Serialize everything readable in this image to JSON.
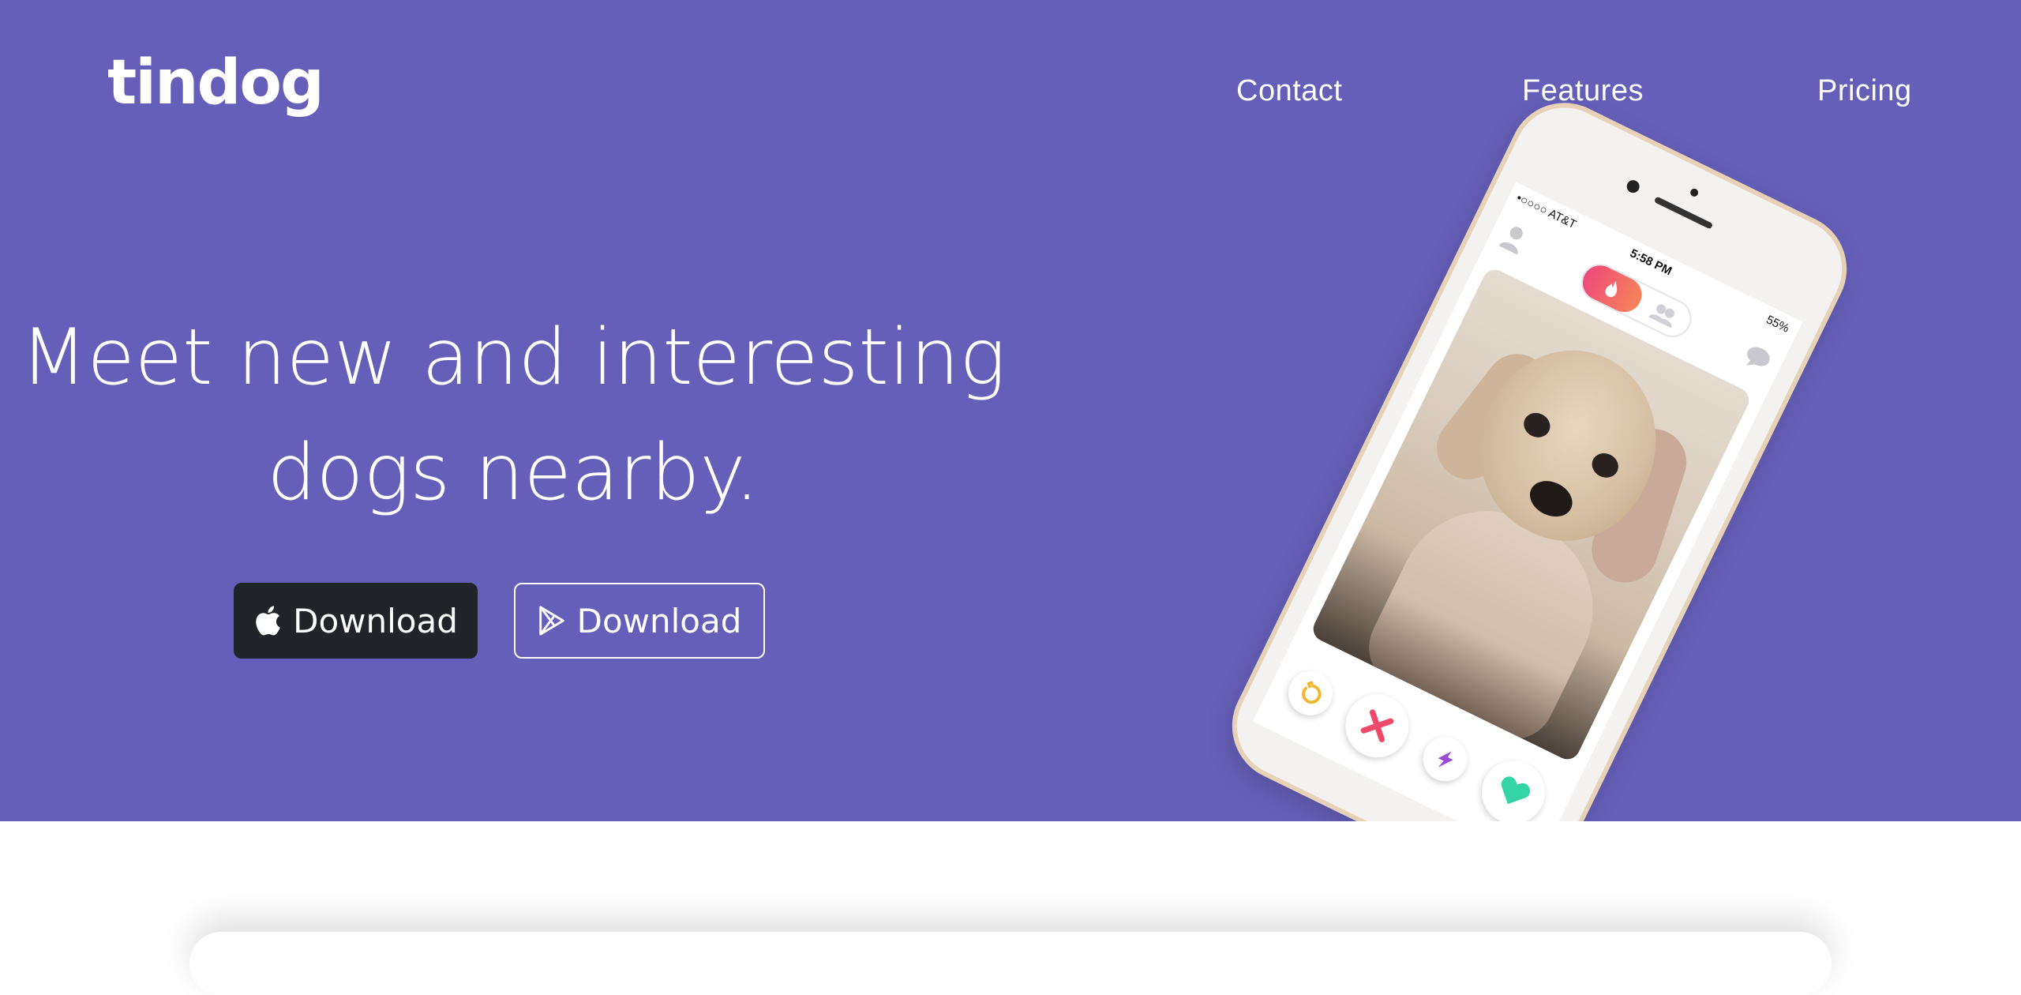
{
  "brand": {
    "name": "tindog"
  },
  "nav": {
    "items": [
      {
        "label": "Contact"
      },
      {
        "label": "Features"
      },
      {
        "label": "Pricing"
      }
    ]
  },
  "hero": {
    "headline_line1": "Meet new and interesting",
    "headline_line2": "dogs nearby.",
    "buttons": [
      {
        "label": "Download",
        "icon": "apple-icon",
        "style": "dark"
      },
      {
        "label": "Download",
        "icon": "google-play-icon",
        "style": "outline"
      }
    ],
    "background_color": "#665fb9"
  },
  "phone": {
    "status": {
      "carrier": "•○○○○ AT&T",
      "time": "5:58 PM",
      "battery": "55%"
    },
    "actions": [
      "rewind-icon",
      "nope-icon",
      "boost-icon",
      "like-icon"
    ]
  }
}
